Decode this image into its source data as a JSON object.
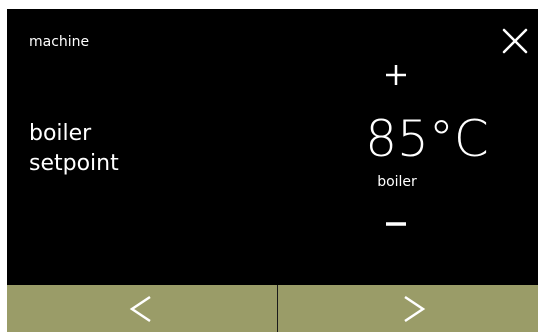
{
  "header": {
    "breadcrumb": "machine"
  },
  "parameter": {
    "label_line1": "boiler",
    "label_line2": "setpoint",
    "value": "85",
    "unit": "°C",
    "sub_label": "boiler"
  },
  "icons": {
    "close": "close-icon",
    "increment": "plus-icon",
    "decrement": "minus-icon",
    "previous": "chevron-left-icon",
    "next": "chevron-right-icon"
  },
  "colors": {
    "background": "#000000",
    "text": "#ffffff",
    "nav_bar": "#9a9c68"
  }
}
